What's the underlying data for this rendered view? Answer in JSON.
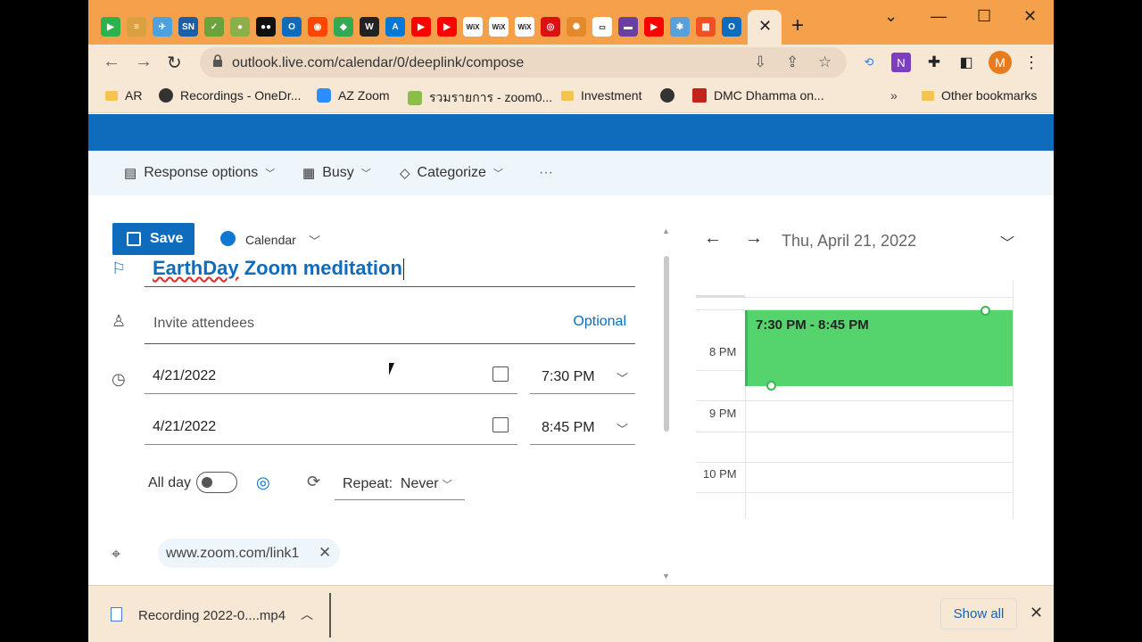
{
  "browser": {
    "tabs": [
      {
        "icon": "feedly-icon",
        "color": "#2bb24c",
        "glyph": "▶"
      },
      {
        "icon": "note-icon",
        "color": "#d9a03f",
        "glyph": "≡"
      },
      {
        "icon": "bird-icon",
        "color": "#4aa3df",
        "glyph": "✈"
      },
      {
        "icon": "syn-icon",
        "color": "#1a5fa8",
        "glyph": "SN"
      },
      {
        "icon": "check-icon",
        "color": "#6aa33b",
        "glyph": "✓"
      },
      {
        "icon": "map-pin-icon",
        "color": "#8bb04a",
        "glyph": "●"
      },
      {
        "icon": "medium-icon",
        "color": "#111111",
        "glyph": "●●"
      },
      {
        "icon": "outlook-icon",
        "color": "#0f6cbd",
        "glyph": "O"
      },
      {
        "icon": "reddit-icon",
        "color": "#ff4500",
        "glyph": "◉"
      },
      {
        "icon": "maps-icon",
        "color": "#34a853",
        "glyph": "◆"
      },
      {
        "icon": "w-icon",
        "color": "#222222",
        "glyph": "W"
      },
      {
        "icon": "azure-icon",
        "color": "#0078d4",
        "glyph": "A"
      },
      {
        "icon": "youtube-icon",
        "color": "#ff0000",
        "glyph": "▶"
      },
      {
        "icon": "youtube-icon",
        "color": "#ff0000",
        "glyph": "▶"
      },
      {
        "icon": "wix-icon",
        "color": "#ffffff",
        "glyph": "WiX"
      },
      {
        "icon": "wix-icon",
        "color": "#ffffff",
        "glyph": "WiX"
      },
      {
        "icon": "wix-icon",
        "color": "#ffffff",
        "glyph": "WiX"
      },
      {
        "icon": "target-icon",
        "color": "#d11",
        "glyph": "◎"
      },
      {
        "icon": "swirl-icon",
        "color": "#e58a2b",
        "glyph": "✺"
      },
      {
        "icon": "window-icon",
        "color": "#ffffff",
        "glyph": "▭"
      },
      {
        "icon": "purple-icon",
        "color": "#6b3fa0",
        "glyph": "▬"
      },
      {
        "icon": "youtube-icon",
        "color": "#ff0000",
        "glyph": "▶"
      },
      {
        "icon": "puzzle-icon",
        "color": "#5aa0d8",
        "glyph": "✱"
      },
      {
        "icon": "microsoft-icon",
        "color": "#f25022",
        "glyph": "▦"
      },
      {
        "icon": "outlook-icon",
        "color": "#0f6cbd",
        "glyph": "O"
      }
    ],
    "url": "outlook.live.com/calendar/0/deeplink/compose",
    "profile_initial": "M",
    "bookmarks": [
      {
        "label": "AR",
        "icon": "folder-icon"
      },
      {
        "label": "Recordings - OneDr...",
        "icon": "globe-icon"
      },
      {
        "label": "AZ Zoom",
        "icon": "zoom-icon"
      },
      {
        "label": "รวมรายการ - zoom0...",
        "icon": "people-icon"
      },
      {
        "label": "Investment",
        "icon": "folder-icon"
      },
      {
        "label": "",
        "icon": "globe-icon"
      },
      {
        "label": "DMC Dhamma on...",
        "icon": "dmc-icon"
      }
    ],
    "bookmarks_more": "»",
    "other_bookmarks": "Other bookmarks"
  },
  "commands": {
    "response_options": "Response options",
    "busy": "Busy",
    "categorize": "Categorize",
    "more": "···"
  },
  "form": {
    "save": "Save",
    "calendar": "Calendar",
    "title_word1": "EarthDay",
    "title_rest": " Zoom meditation",
    "attendees_placeholder": "Invite attendees",
    "optional": "Optional",
    "start_date": "4/21/2022",
    "start_time": "7:30 PM",
    "end_date": "4/21/2022",
    "end_time": "8:45 PM",
    "all_day": "All day",
    "repeat": "Repeat:  Never",
    "location": "www.zoom.com/link1"
  },
  "day_view": {
    "date": "Thu, April 21, 2022",
    "hours": [
      "8 PM",
      "9 PM",
      "10 PM"
    ],
    "event_time": "7:30 PM - 8:45 PM",
    "event_color": "#55d46e"
  },
  "downloads": {
    "file": "Recording 2022-0....mp4",
    "show_all": "Show all"
  }
}
